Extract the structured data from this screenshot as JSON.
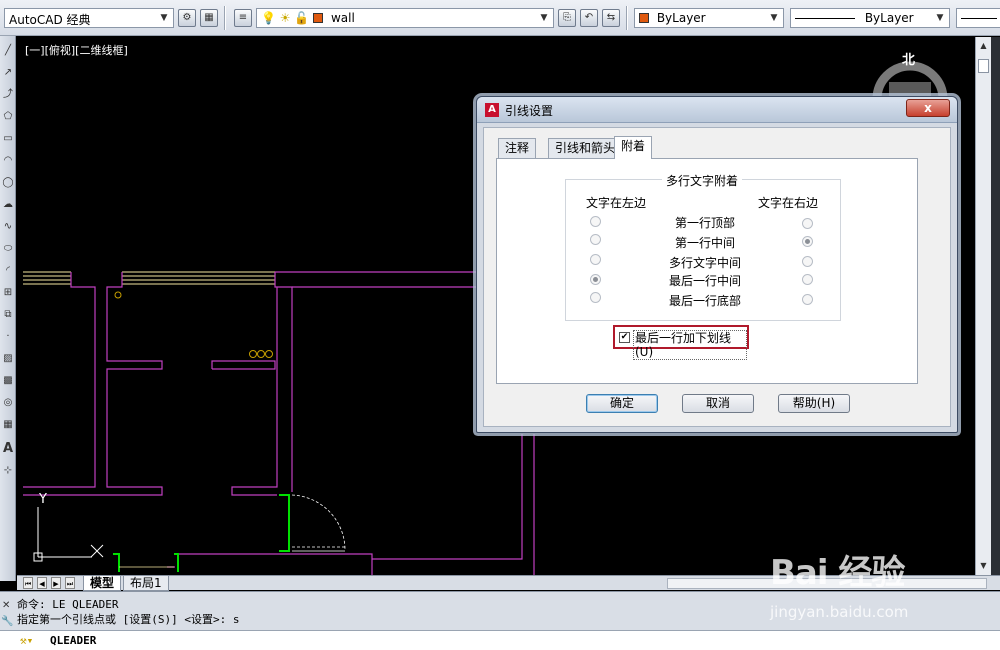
{
  "toolbar": {
    "workspace": "AutoCAD 经典",
    "layer": "wall",
    "color": "ByLayer",
    "linetype": "ByLayer"
  },
  "viewport_label": "[一][俯视][二维线框]",
  "compass": {
    "north": "北"
  },
  "dialog": {
    "title": "引线设置",
    "close": "x",
    "tabs": [
      "注释",
      "引线和箭头",
      "附着"
    ],
    "active_tab": "附着",
    "group_title": "多行文字附着",
    "left_header": "文字在左边",
    "right_header": "文字在右边",
    "options": [
      {
        "label": "第一行顶部",
        "left": false,
        "right": false
      },
      {
        "label": "第一行中间",
        "left": false,
        "right": true
      },
      {
        "label": "多行文字中间",
        "left": false,
        "right": false
      },
      {
        "label": "最后一行中间",
        "left": true,
        "right": false
      },
      {
        "label": "最后一行底部",
        "left": false,
        "right": false
      }
    ],
    "checkbox_label": "最后一行加下划线(U)",
    "checkbox_checked": true,
    "ok": "确定",
    "cancel": "取消",
    "help": "帮助(H)"
  },
  "layout_tabs": [
    "模型",
    "布局1"
  ],
  "command": {
    "history_1": "命令: LE QLEADER",
    "history_2": "指定第一个引线点或 [设置(S)] <设置>: s",
    "current": "QLEADER"
  },
  "watermark": {
    "logo": "Bai 经验",
    "url": "jingyan.baidu.com"
  },
  "colors": {
    "wall": "#c040c0",
    "door": "#00e000",
    "hatch": "#f5e6a0",
    "ucs": "#ffffff"
  }
}
